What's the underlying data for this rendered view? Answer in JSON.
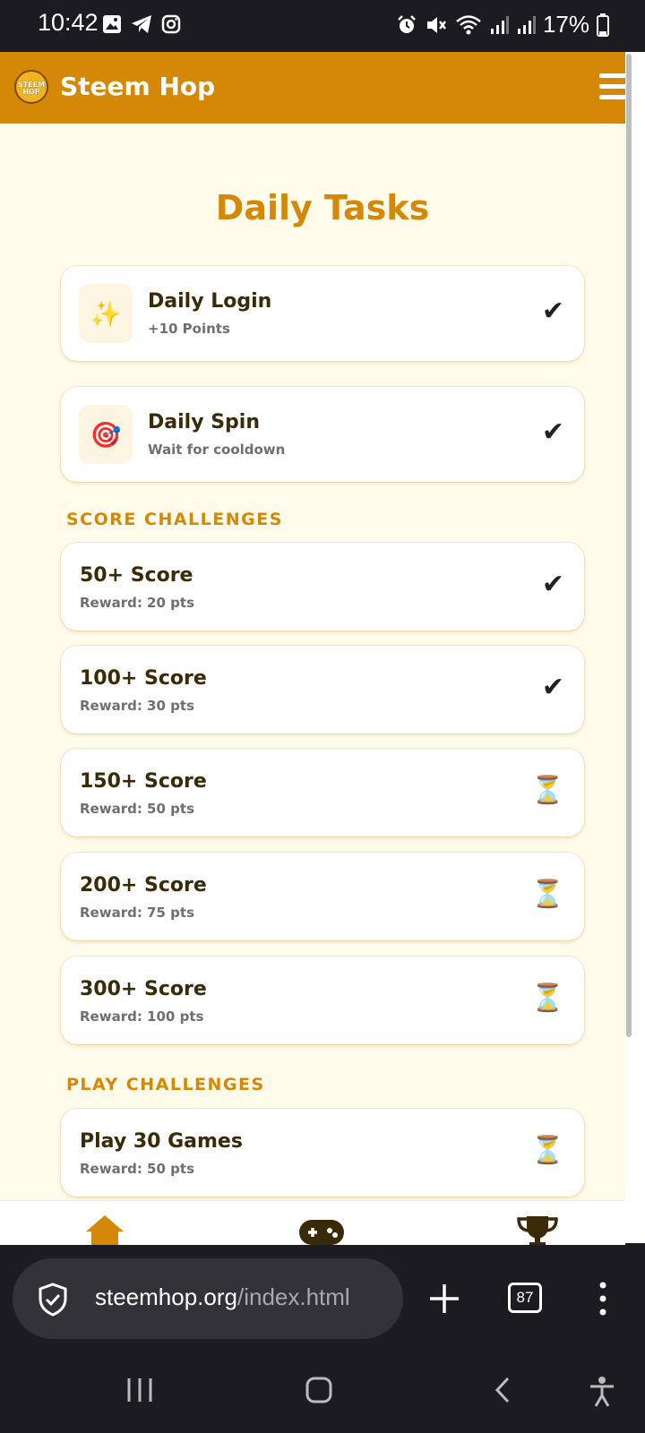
{
  "status_bar": {
    "time": "10:42",
    "battery": "17%",
    "left_icons": [
      "gallery-icon",
      "telegram-icon",
      "instagram-icon"
    ],
    "right_icons": [
      "alarm-icon",
      "mute-icon",
      "wifi-icon",
      "signal-icon",
      "signal-icon",
      "battery-icon"
    ]
  },
  "app_header": {
    "logo_text": "STEEM HOP",
    "title": "Steem Hop",
    "menu_icon": "hamburger-icon"
  },
  "page": {
    "title": "Daily Tasks"
  },
  "daily_tasks": [
    {
      "title": "Daily Login",
      "subtitle": "+10 Points",
      "icon": "✨",
      "status": "completed"
    },
    {
      "title": "Daily Spin",
      "subtitle": "Wait for cooldown",
      "icon": "🎯",
      "status": "completed"
    }
  ],
  "score_challenges": {
    "heading": "SCORE CHALLENGES",
    "items": [
      {
        "title": "50+ Score",
        "subtitle": "Reward: 20 pts",
        "status": "completed"
      },
      {
        "title": "100+ Score",
        "subtitle": "Reward: 30 pts",
        "status": "completed"
      },
      {
        "title": "150+ Score",
        "subtitle": "Reward: 50 pts",
        "status": "pending"
      },
      {
        "title": "200+ Score",
        "subtitle": "Reward: 75 pts",
        "status": "pending"
      },
      {
        "title": "300+ Score",
        "subtitle": "Reward: 100 pts",
        "status": "pending"
      }
    ]
  },
  "play_challenges": {
    "heading": "PLAY CHALLENGES",
    "items": [
      {
        "title": "Play 30 Games",
        "subtitle": "Reward: 50 pts",
        "status": "pending"
      }
    ]
  },
  "status_glyphs": {
    "completed": "✔",
    "pending": "⏳"
  },
  "bottom_nav": [
    "home-icon",
    "gamepad-icon",
    "trophy-icon"
  ],
  "browser": {
    "url_host": "steemhop.org",
    "url_path": "/index.html",
    "tab_count": "87"
  },
  "colors": {
    "header": "#d48806",
    "background": "#fffbea",
    "accent": "#d48806",
    "title_text": "#3a2a08"
  }
}
